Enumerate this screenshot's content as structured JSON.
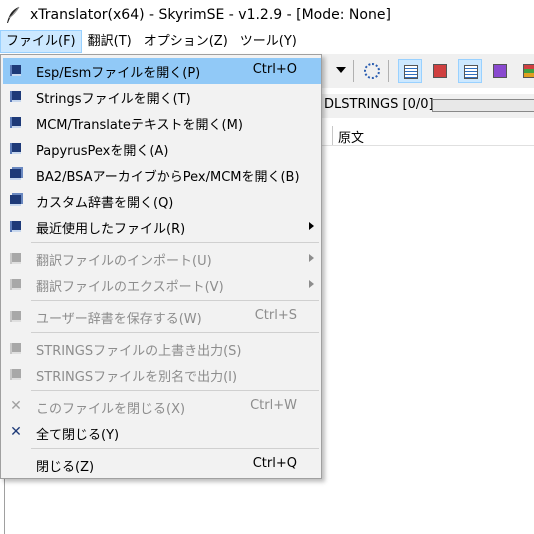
{
  "window": {
    "title": "xTranslator(x64) - SkyrimSE - v1.2.9 - [Mode: None]",
    "icon": "quill-icon"
  },
  "menubar": [
    "ファイル(F)",
    "翻訳(T)",
    "オプション(Z)",
    "ツール(Y)"
  ],
  "status": {
    "text": "DLSTRINGS [0/0]"
  },
  "list_header": {
    "col2": "原文"
  },
  "file_menu": {
    "items": [
      {
        "label": "Esp/Esmファイルを開く(P)",
        "shortcut": "Ctrl+O",
        "icon": "open-file-icon",
        "highlighted": true
      },
      {
        "label": "Stringsファイルを開く(T)",
        "shortcut": "",
        "icon": "open-file-icon"
      },
      {
        "label": "MCM/Translateテキストを開く(M)",
        "shortcut": "",
        "icon": "open-file-icon"
      },
      {
        "label": "PapyrusPexを開く(A)",
        "shortcut": "",
        "icon": "open-file-icon"
      },
      {
        "label": "BA2/BSAアーカイブからPex/MCMを開く(B)",
        "shortcut": "",
        "icon": "archive-icon"
      },
      {
        "label": "カスタム辞書を開く(Q)",
        "shortcut": "",
        "icon": "dictionary-icon"
      },
      {
        "label": "最近使用したファイル(R)",
        "shortcut": "",
        "icon": "recent-files-icon",
        "submenu": true
      },
      {
        "label": "翻訳ファイルのインポート(U)",
        "shortcut": "",
        "icon": "import-icon",
        "submenu": true,
        "disabled": true
      },
      {
        "label": "翻訳ファイルのエクスポート(V)",
        "shortcut": "",
        "icon": "export-icon",
        "submenu": true,
        "disabled": true
      },
      {
        "label": "ユーザー辞書を保存する(W)",
        "shortcut": "Ctrl+S",
        "icon": "save-icon",
        "disabled": true
      },
      {
        "label": "STRINGSファイルの上書き出力(S)",
        "shortcut": "",
        "icon": "save-icon",
        "disabled": true
      },
      {
        "label": "STRINGSファイルを別名で出力(I)",
        "shortcut": "",
        "icon": "save-as-icon",
        "disabled": true
      },
      {
        "label": "このファイルを閉じる(X)",
        "shortcut": "Ctrl+W",
        "icon": "close-icon",
        "disabled": true
      },
      {
        "label": "全て閉じる(Y)",
        "shortcut": "",
        "icon": "close-all-icon"
      },
      {
        "label": "閉じる(Z)",
        "shortcut": "Ctrl+Q",
        "icon": ""
      }
    ]
  }
}
